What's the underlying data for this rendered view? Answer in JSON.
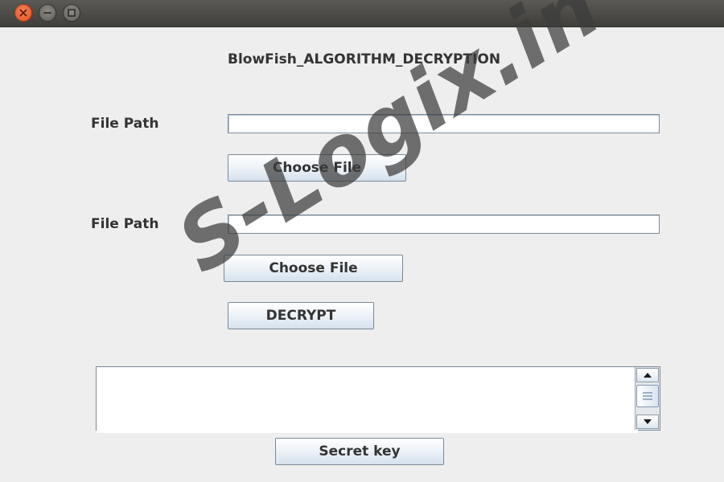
{
  "window": {
    "controls": [
      "close-icon",
      "minimize-icon",
      "maximize-icon"
    ]
  },
  "header": {
    "title": "BlowFish_ALGORITHM_DECRYPTION"
  },
  "form": {
    "file_path_1": {
      "label": "File Path",
      "value": "",
      "button_label": "Choose File"
    },
    "file_path_2": {
      "label": "File Path",
      "value": "",
      "button_label": "Choose File"
    },
    "decrypt_label": "DECRYPT",
    "output_text": "",
    "secret_key_label": "Secret key"
  },
  "scrollbar": {
    "icons": [
      "arrow-up-icon",
      "scroll-thumb-grip-icon",
      "arrow-down-icon"
    ]
  },
  "watermark": {
    "text": "S-Logix.in"
  },
  "colors": {
    "close_button": "#e0521f",
    "titlebar": "#403f3b",
    "window_bg": "#eeeeee",
    "button_gradient_end": "#d6e2ee"
  }
}
